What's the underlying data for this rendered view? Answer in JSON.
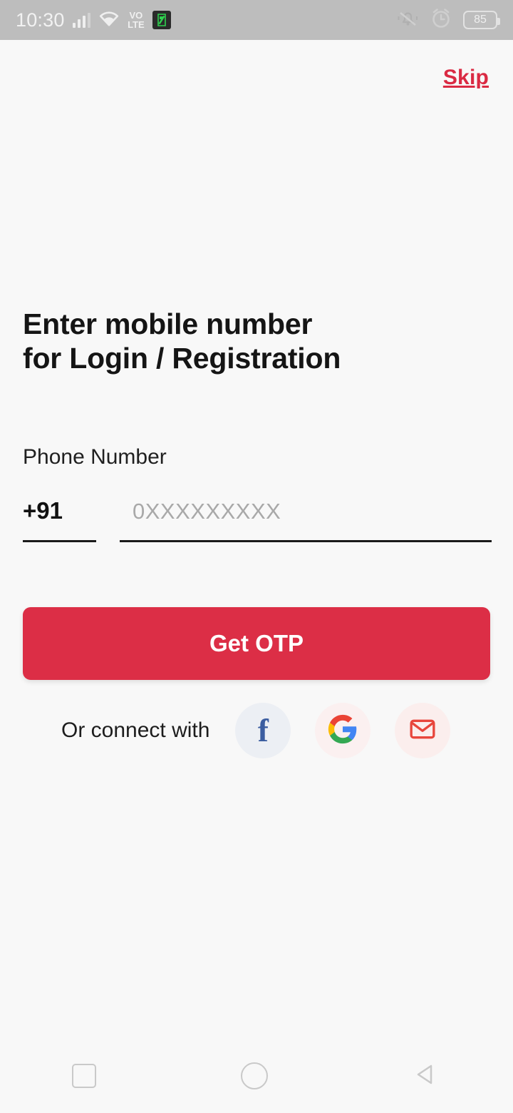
{
  "status_bar": {
    "time": "10:30",
    "signal_icon": "cellular-signal-icon",
    "wifi_icon": "wifi-icon",
    "volte_line1": "VO",
    "volte_line2": "LTE",
    "app_notification_icon": "app-notification-icon",
    "mute_icon": "bell-muted-icon",
    "alarm_icon": "alarm-clock-icon",
    "battery_level": "85"
  },
  "header": {
    "skip_label": "Skip"
  },
  "main": {
    "heading_line1": "Enter mobile number",
    "heading_line2_prefix": "for ",
    "heading_line2_bold": "Login / Registration",
    "phone_label": "Phone Number",
    "country_code": "+91",
    "phone_placeholder": "0XXXXXXXXX",
    "phone_value": "",
    "submit_label": "Get OTP",
    "social_text": "Or connect with",
    "social_buttons": [
      {
        "name": "facebook",
        "glyph": "f"
      },
      {
        "name": "google",
        "glyph": "G"
      },
      {
        "name": "email",
        "glyph": "envelope"
      }
    ]
  },
  "nav_bar": {
    "recents_icon": "square-recents-icon",
    "home_icon": "circle-home-icon",
    "back_icon": "triangle-back-icon"
  },
  "colors": {
    "accent_red": "#dc2e46",
    "skip_red": "#da2a43",
    "background": "#f8f8f8",
    "status_bar": "#bdbdbd",
    "facebook_blue": "#3b5da0",
    "email_red": "#e8463c"
  }
}
